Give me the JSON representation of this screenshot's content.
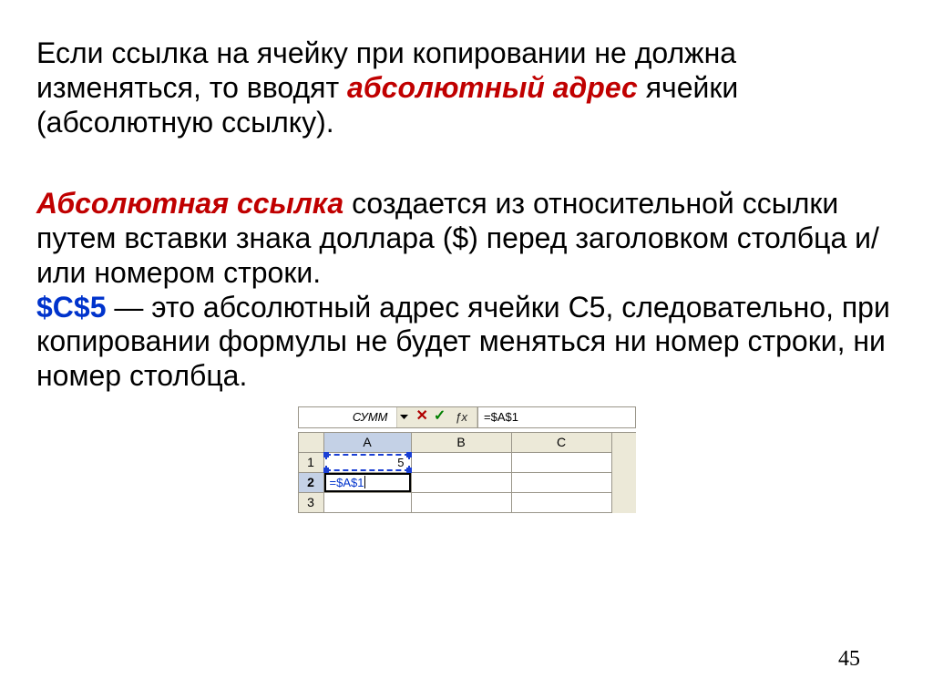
{
  "text": {
    "p1_a": "Если ссылка на ячейку при копировании не должна изменяться, то вводят ",
    "p1_em": "абсолютный адрес",
    "p1_b": " ячейки (абсолютную ссылку).",
    "p2_em": "Абсолютная ссылка",
    "p2_a": " создается из относительной ссылки путем вставки знака доллара ($) перед заголовком столбца и/или номером строки.",
    "p3_em": "$C$5",
    "p3_a": " — это абсолютный адрес ячейки С5, следовательно, при копировании формулы не будет меняться ни номер строки, ни номер столбца."
  },
  "excel": {
    "namebox": "СУММ",
    "formula": "=$A$1",
    "columns": {
      "A": "A",
      "B": "B",
      "C": "C"
    },
    "rows": {
      "r1": "1",
      "r2": "2",
      "r3": "3"
    },
    "cells": {
      "A1": "5",
      "A2": "=$A$1"
    },
    "icons": {
      "cancel": "cancel-icon",
      "enter": "enter-icon",
      "fx": "fx-icon",
      "dropdown": "dropdown-icon"
    }
  },
  "page_number": "45"
}
